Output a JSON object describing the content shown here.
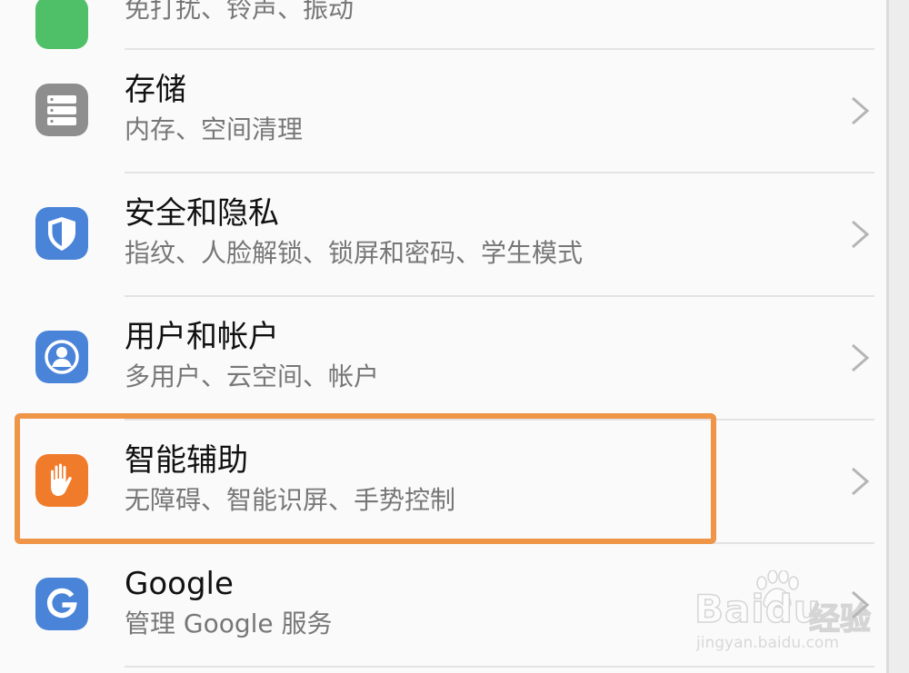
{
  "settings": {
    "items": [
      {
        "subtitle": "免打扰、铃声、振动",
        "icon": "green-settings-icon",
        "color": "#4fc068"
      },
      {
        "title": "存储",
        "subtitle": "内存、空间清理",
        "icon": "storage-icon",
        "color": "#8e8e8e"
      },
      {
        "title": "安全和隐私",
        "subtitle": "指纹、人脸解锁、锁屏和密码、学生模式",
        "icon": "shield-icon",
        "color": "#4a84d8"
      },
      {
        "title": "用户和帐户",
        "subtitle": "多用户、云空间、帐户",
        "icon": "user-account-icon",
        "color": "#4a84d8"
      },
      {
        "title": "智能辅助",
        "subtitle": "无障碍、智能识屏、手势控制",
        "icon": "hand-icon",
        "color": "#f07b2b",
        "highlighted": true
      },
      {
        "title": "Google",
        "subtitle": "管理 Google 服务",
        "icon": "google-icon",
        "color": "#4a84d8"
      }
    ]
  },
  "highlight_color": "#ef9548",
  "watermark": {
    "brand": "Bai",
    "brand2": "du",
    "cn": "经验",
    "url": "jingyan.baidu.com"
  }
}
